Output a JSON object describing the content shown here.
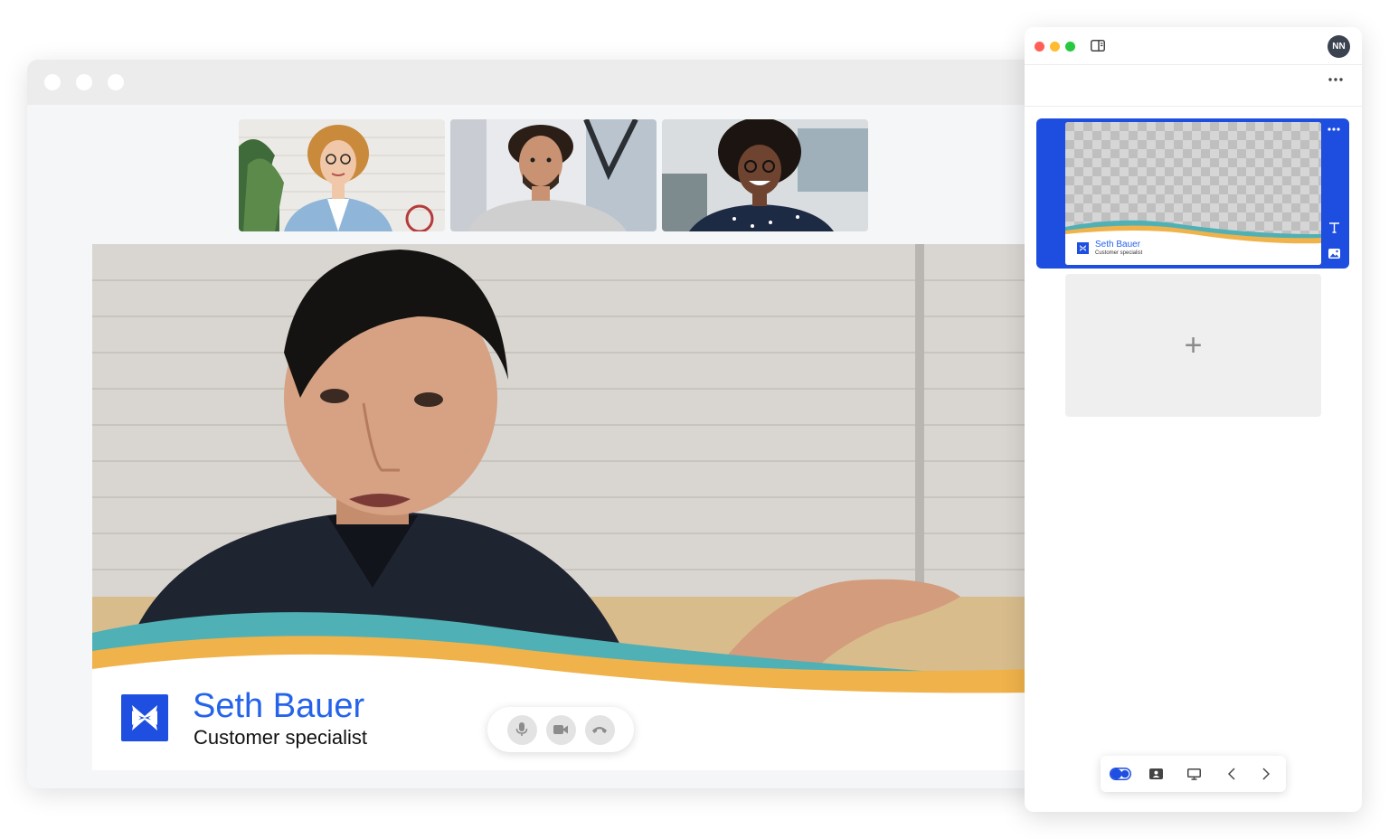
{
  "meeting": {
    "participants": [
      {
        "avatar": "participant-woman-curly-hair"
      },
      {
        "avatar": "participant-man-beard"
      },
      {
        "avatar": "participant-woman-afro"
      }
    ],
    "speaker": {
      "name": "Seth Bauer",
      "role": "Customer specialist"
    },
    "controls": [
      {
        "icon": "microphone-icon"
      },
      {
        "icon": "camera-icon"
      },
      {
        "icon": "hang-up-icon"
      }
    ]
  },
  "panel": {
    "user_initials": "NN",
    "scene": {
      "name": "Seth Bauer",
      "role": "Customer specialist"
    },
    "add_scene_symbol": "+"
  },
  "colors": {
    "brand_blue": "#1f4fe0",
    "name_blue": "#2563eb",
    "wave_teal": "#4fb0b6",
    "wave_orange": "#f0b24a",
    "selected_card": "#1d4ee0",
    "traffic_red": "#ff5f57",
    "traffic_yellow": "#febc2e",
    "traffic_green": "#28c840"
  }
}
